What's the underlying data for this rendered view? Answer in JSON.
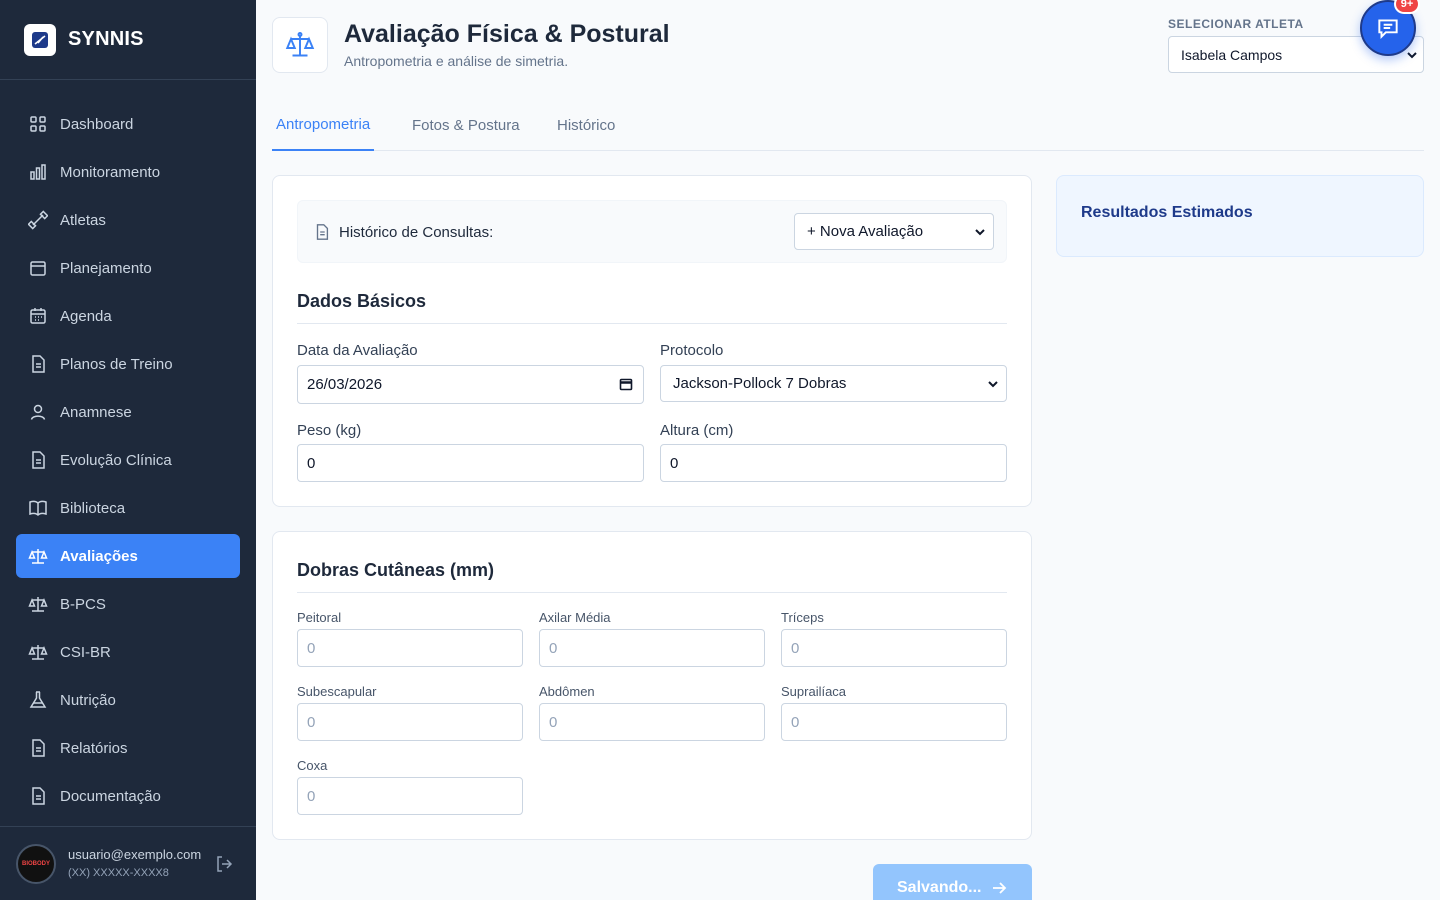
{
  "app": {
    "name": "SYNNIS",
    "logo_icon": "swoosh-icon"
  },
  "sidebar": {
    "items": [
      {
        "label": "Dashboard",
        "icon": "grid-icon",
        "active": false
      },
      {
        "label": "Monitoramento",
        "icon": "bar-chart-icon",
        "active": false
      },
      {
        "label": "Atletas",
        "icon": "dumbbell-icon",
        "active": false
      },
      {
        "label": "Planejamento",
        "icon": "calendar-blank-icon",
        "active": false
      },
      {
        "label": "Agenda",
        "icon": "calendar-icon",
        "active": false
      },
      {
        "label": "Planos de Treino",
        "icon": "document-icon",
        "active": false
      },
      {
        "label": "Anamnese",
        "icon": "user-icon",
        "active": false
      },
      {
        "label": "Evolução Clínica",
        "icon": "document-icon",
        "active": false
      },
      {
        "label": "Biblioteca",
        "icon": "book-icon",
        "active": false
      },
      {
        "label": "Avaliações",
        "icon": "scale-icon",
        "active": true
      },
      {
        "label": "B-PCS",
        "icon": "scale-icon",
        "active": false
      },
      {
        "label": "CSI-BR",
        "icon": "scale-icon",
        "active": false
      },
      {
        "label": "Nutrição",
        "icon": "flask-icon",
        "active": false
      },
      {
        "label": "Relatórios",
        "icon": "document-icon",
        "active": false
      },
      {
        "label": "Documentação",
        "icon": "document-icon",
        "active": false
      }
    ]
  },
  "user": {
    "email": "usuario@exemplo.com",
    "phone": "(XX) XXXXX-XXXX8",
    "avatar_text": "BIOBODY"
  },
  "header": {
    "title": "Avaliação Física & Postural",
    "subtitle": "Antropometria e análise de simetria.",
    "athlete_label": "SELECIONAR ATLETA",
    "athlete_value": "Isabela Campos",
    "chat_badge": "9+"
  },
  "tabs": [
    {
      "label": "Antropometria",
      "active": true
    },
    {
      "label": "Fotos & Postura",
      "active": false
    },
    {
      "label": "Histórico",
      "active": false
    }
  ],
  "history": {
    "label": "Histórico de Consultas:",
    "select_value": "+ Nova Avaliação"
  },
  "basic": {
    "title": "Dados Básicos",
    "date_label": "Data da Avaliação",
    "date_value": "26/03/2026",
    "protocol_label": "Protocolo",
    "protocol_value": "Jackson-Pollock 7 Dobras",
    "weight_label": "Peso (kg)",
    "weight_value": "0",
    "height_label": "Altura (cm)",
    "height_value": "0"
  },
  "skinfolds": {
    "title": "Dobras Cutâneas (mm)",
    "fields": [
      {
        "label": "Peitoral",
        "placeholder": "0"
      },
      {
        "label": "Axilar Média",
        "placeholder": "0"
      },
      {
        "label": "Tríceps",
        "placeholder": "0"
      },
      {
        "label": "Subescapular",
        "placeholder": "0"
      },
      {
        "label": "Abdômen",
        "placeholder": "0"
      },
      {
        "label": "Suprailíaca",
        "placeholder": "0"
      },
      {
        "label": "Coxa",
        "placeholder": "0"
      }
    ]
  },
  "results": {
    "title": "Resultados Estimados"
  },
  "save": {
    "label": "Salvando..."
  },
  "colors": {
    "sidebar": "#1e293b",
    "accent": "#3b82f6",
    "badge": "#ef4444"
  }
}
